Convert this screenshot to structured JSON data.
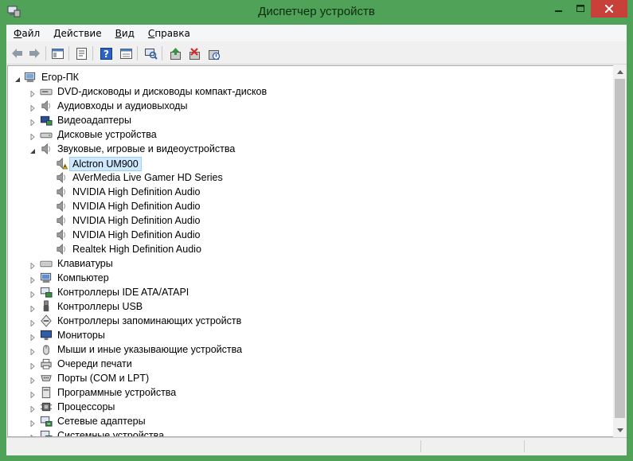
{
  "window": {
    "title": "Диспетчер устройств",
    "colors": {
      "frame": "#4fa257",
      "close": "#c7413a",
      "selection": "#cde8ff"
    }
  },
  "menu": [
    {
      "pre": "",
      "key": "Ф",
      "post": "айл"
    },
    {
      "pre": "",
      "key": "Д",
      "post": "ействие"
    },
    {
      "pre": "",
      "key": "В",
      "post": "ид"
    },
    {
      "pre": "",
      "key": "С",
      "post": "правка"
    }
  ],
  "toolbar": {
    "icons": [
      "back-icon",
      "forward-icon",
      "show-hide-tree-icon",
      "properties-icon",
      "help-icon",
      "action-view-icon",
      "scan-hardware-icon",
      "update-driver-icon",
      "uninstall-icon",
      "disable-device-icon"
    ]
  },
  "tree": {
    "root": "Егор-ПК",
    "categories": [
      {
        "label": "DVD-дисководы и дисководы компакт-дисков",
        "icon": "dvd-drive-icon"
      },
      {
        "label": "Аудиовходы и аудиовыходы",
        "icon": "speaker-icon"
      },
      {
        "label": "Видеоадаптеры",
        "icon": "display-adapter-icon"
      },
      {
        "label": "Дисковые устройства",
        "icon": "disk-drive-icon"
      },
      {
        "label": "Звуковые, игровые и видеоустройства",
        "icon": "speaker-icon",
        "expanded": true,
        "children": [
          {
            "label": "Alctron UM900",
            "icon": "speaker-warning-icon",
            "selected": true
          },
          {
            "label": "AVerMedia Live Gamer HD Series",
            "icon": "speaker-icon"
          },
          {
            "label": "NVIDIA High Definition Audio",
            "icon": "speaker-icon"
          },
          {
            "label": "NVIDIA High Definition Audio",
            "icon": "speaker-icon"
          },
          {
            "label": "NVIDIA High Definition Audio",
            "icon": "speaker-icon"
          },
          {
            "label": "NVIDIA High Definition Audio",
            "icon": "speaker-icon"
          },
          {
            "label": "Realtek High Definition Audio",
            "icon": "speaker-icon"
          }
        ]
      },
      {
        "label": "Клавиатуры",
        "icon": "keyboard-icon"
      },
      {
        "label": "Компьютер",
        "icon": "computer-icon"
      },
      {
        "label": "Контроллеры IDE ATA/ATAPI",
        "icon": "ide-controller-icon"
      },
      {
        "label": "Контроллеры USB",
        "icon": "usb-icon"
      },
      {
        "label": "Контроллеры запоминающих устройств",
        "icon": "storage-controller-icon"
      },
      {
        "label": "Мониторы",
        "icon": "monitor-icon"
      },
      {
        "label": "Мыши и иные указывающие устройства",
        "icon": "mouse-icon"
      },
      {
        "label": "Очереди печати",
        "icon": "printer-icon"
      },
      {
        "label": "Порты (COM и LPT)",
        "icon": "port-icon"
      },
      {
        "label": "Программные устройства",
        "icon": "software-device-icon"
      },
      {
        "label": "Процессоры",
        "icon": "processor-icon"
      },
      {
        "label": "Сетевые адаптеры",
        "icon": "network-adapter-icon"
      },
      {
        "label": "Системные устройства",
        "icon": "system-device-icon"
      }
    ]
  }
}
